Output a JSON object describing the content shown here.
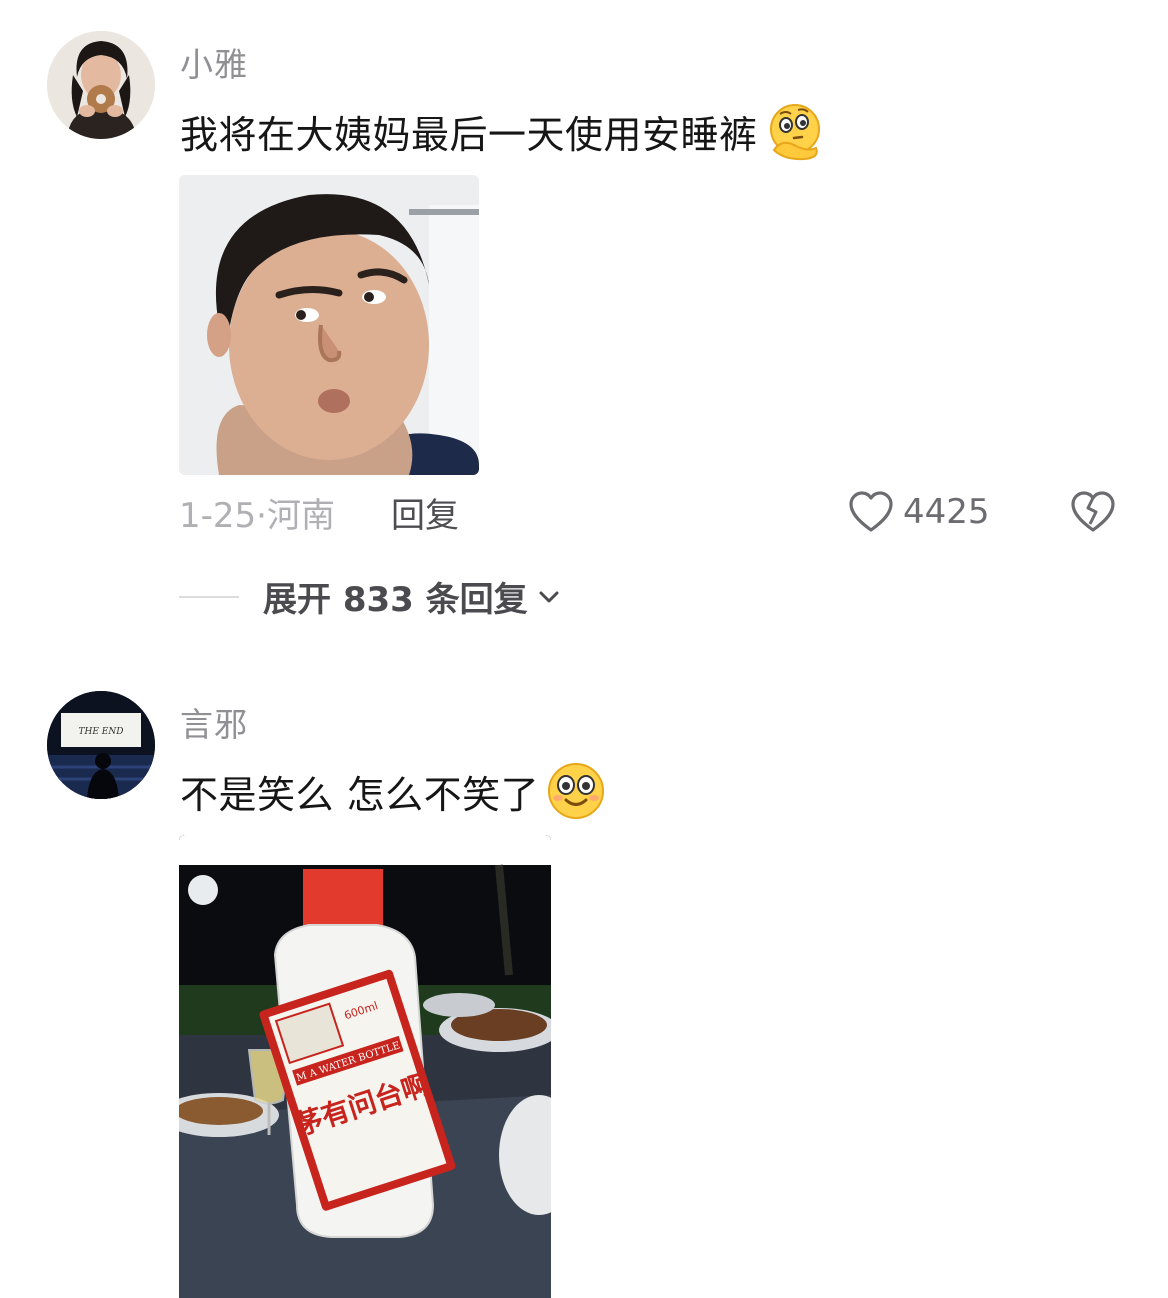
{
  "comments": [
    {
      "username": "小雅",
      "text": "我将在大姨妈最后一天使用安睡裤",
      "emoji": "thinking-face-icon",
      "date": "1-25",
      "separator": "·",
      "location": "河南",
      "reply_label": "回复",
      "like_count": "4425",
      "expand_label": "展开 833 条回复"
    },
    {
      "username": "言邪",
      "text": "不是笑么 怎么不笑了",
      "emoji": "smiling-face-icon"
    }
  ],
  "image_text": {
    "bottle_label": "茅有问台啊",
    "bottle_sub": "M A WATER BOTTLE",
    "bottle_volume": "600ml",
    "avatar_screen": "THE END"
  }
}
